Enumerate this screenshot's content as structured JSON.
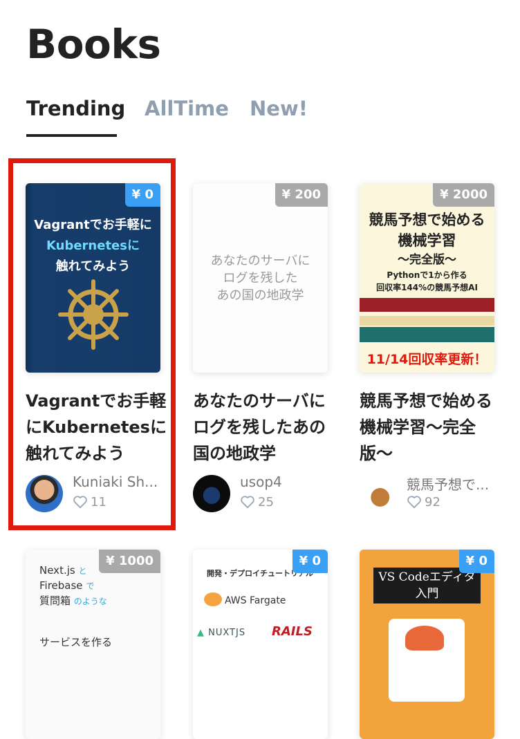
{
  "page": {
    "title": "Books"
  },
  "tabs": [
    {
      "label": "Trending",
      "active": true
    },
    {
      "label": "AllTime",
      "active": false
    },
    {
      "label": "New!",
      "active": false
    }
  ],
  "books": [
    {
      "price": "¥ 0",
      "cover_lines": [
        "Vagrantでお手軽に",
        "Kubernetesに",
        "触れてみよう"
      ],
      "title": "Vagrantでお手軽にKubernetesに触れてみよう",
      "author": "Kuniaki Sh...",
      "likes": "11",
      "highlighted": true
    },
    {
      "price": "¥ 200",
      "cover_lines": [
        "あなたのサーバに",
        "ログを残した",
        "あの国の地政学"
      ],
      "title": "あなたのサーバにログを残したあの国の地政学",
      "author": "usop4",
      "likes": "25"
    },
    {
      "price": "¥ 2000",
      "cover_lines": [
        "競馬予想で始める",
        "機械学習",
        "〜完全版〜",
        "Pythonで1から作る",
        "回収率144%の競馬予想AI",
        "11/14回収率更新！"
      ],
      "title": "競馬予想で始める機械学習〜完全版〜",
      "author": "競馬予想で...",
      "likes": "92"
    },
    {
      "price": "¥ 1000",
      "cover_lines": [
        "Next.js",
        "と",
        "Firebase",
        "で",
        "質問箱",
        "のような",
        "サービスを作る"
      ]
    },
    {
      "price": "¥ 0",
      "cover_lines": [
        "開発・デプロイチュートリアル",
        "AWS Fargate",
        "NUXTJS",
        "RAILS"
      ]
    },
    {
      "price": "¥ 0",
      "cover_lines": [
        "VS Codeエディタ",
        "入門"
      ]
    }
  ],
  "colors": {
    "highlight": "#e0190d",
    "free_badge": "#3aa0f5",
    "paid_badge": "#a9a9a9",
    "tab_inactive": "#8f9fb0"
  },
  "icons": [
    "heart-outline-icon",
    "ship-wheel-icon"
  ]
}
